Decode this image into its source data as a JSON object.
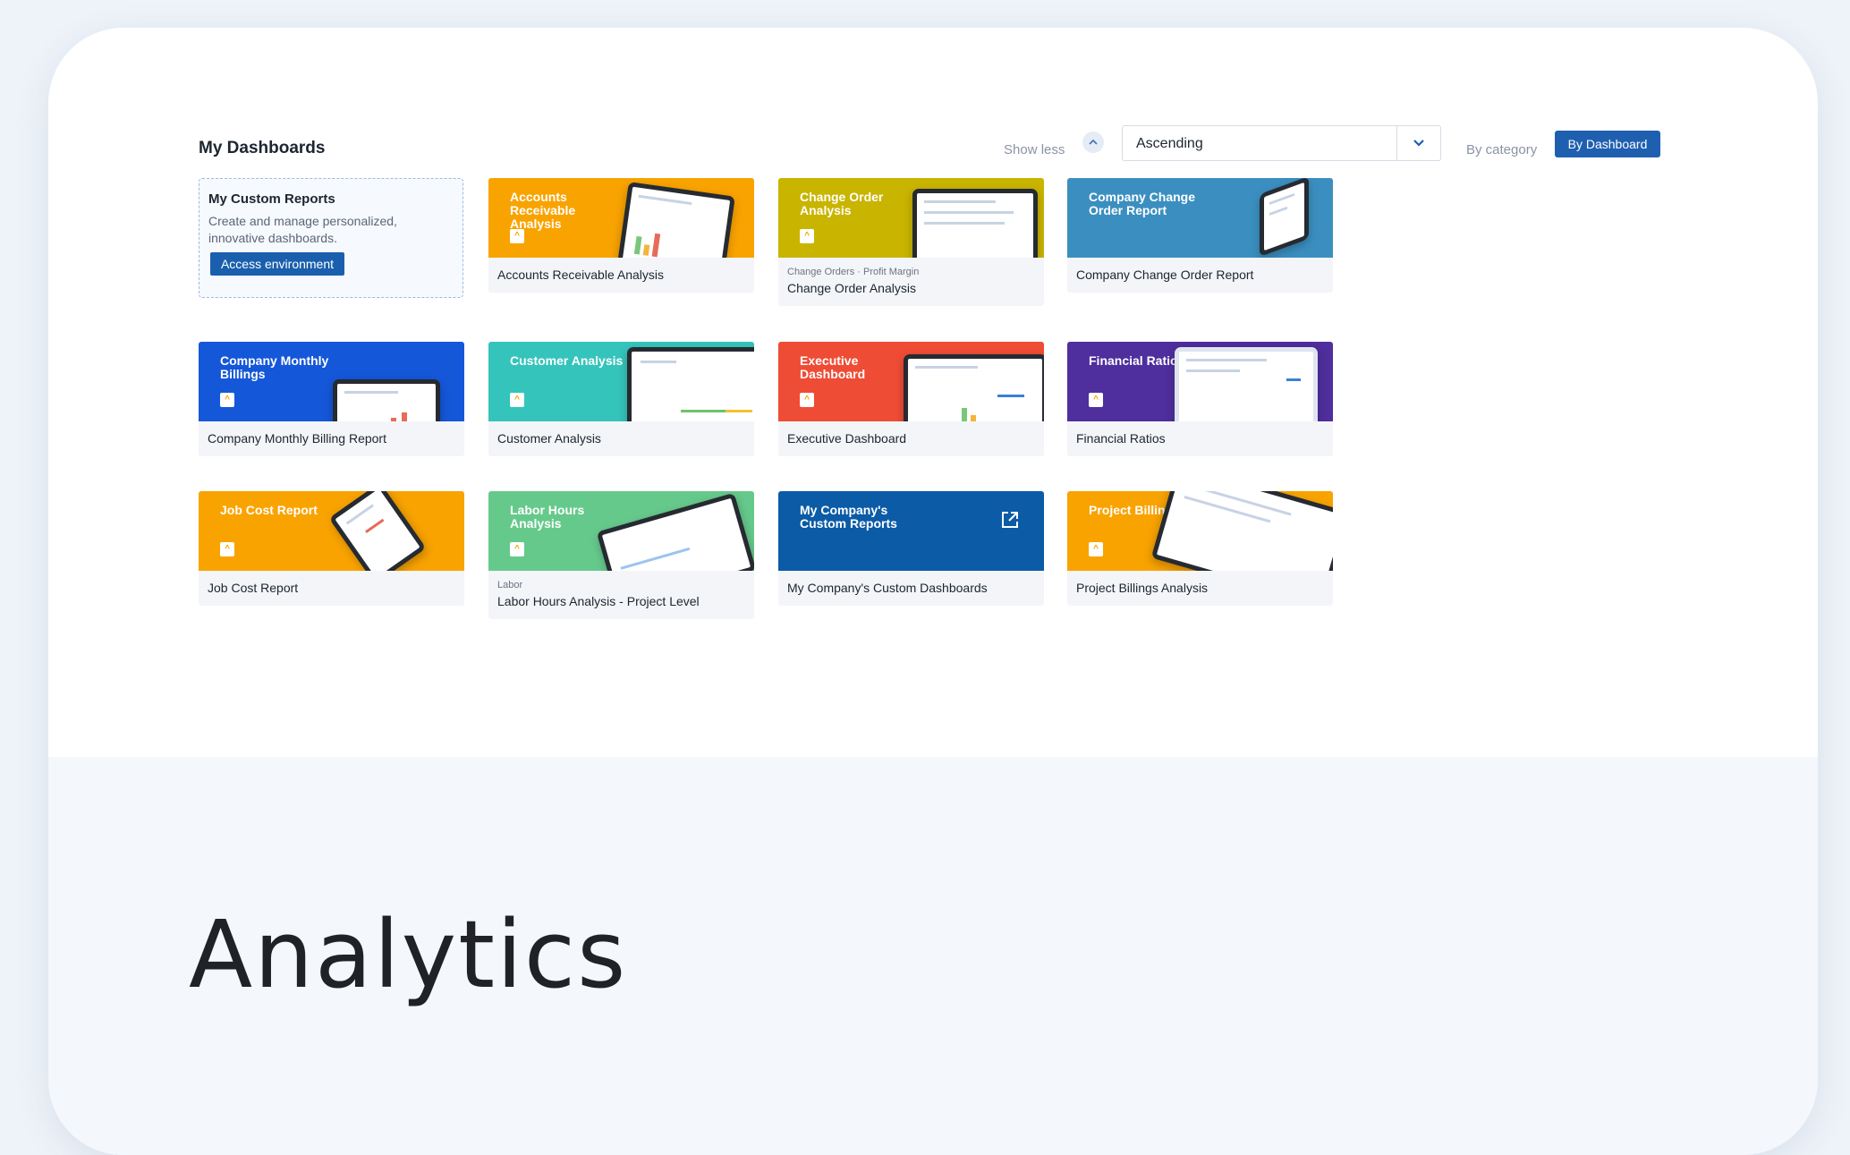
{
  "header": {
    "title": "My Dashboards",
    "show_less": "Show less",
    "sort_value": "Ascending",
    "by_category": "By category",
    "by_dashboard": "By Dashboard"
  },
  "custom_reports": {
    "title": "My Custom Reports",
    "description": "Create and manage personalized, innovative dashboards.",
    "button": "Access environment"
  },
  "cards": [
    {
      "banner": "Accounts Receivable Analysis",
      "label": "Accounts Receivable Analysis",
      "color": "#f9a300"
    },
    {
      "banner": "Change Order Analysis",
      "label": "Change Order Analysis",
      "tags": "Change Orders  ·  Profit Margin",
      "color": "#c9b400"
    },
    {
      "banner": "Company Change Order Report",
      "label": "Company Change Order Report",
      "color": "#3b8fc0"
    },
    {
      "banner": "Company Monthly Billings",
      "label": "Company Monthly Billing Report",
      "color": "#1557d9"
    },
    {
      "banner": "Customer Analysis",
      "label": "Customer Analysis",
      "color": "#34c4bb"
    },
    {
      "banner": "Executive Dashboard",
      "label": "Executive Dashboard",
      "color": "#ef4c35"
    },
    {
      "banner": "Financial Ratio",
      "label": "Financial Ratios",
      "color": "#4f2e9d"
    },
    {
      "banner": "Job Cost Report",
      "label": "Job Cost Report",
      "color": "#f9a300"
    },
    {
      "banner": "Labor Hours Analysis",
      "label": "Labor Hours Analysis - Project Level",
      "tags": "Labor",
      "color": "#66c98c"
    },
    {
      "banner": "My Company's Custom Reports",
      "label": "My Company's Custom Dashboards",
      "color": "#0b5ba6"
    },
    {
      "banner": "Project Billing",
      "label": "Project Billings Analysis",
      "color": "#f9a300"
    }
  ],
  "section_title": "Analytics"
}
